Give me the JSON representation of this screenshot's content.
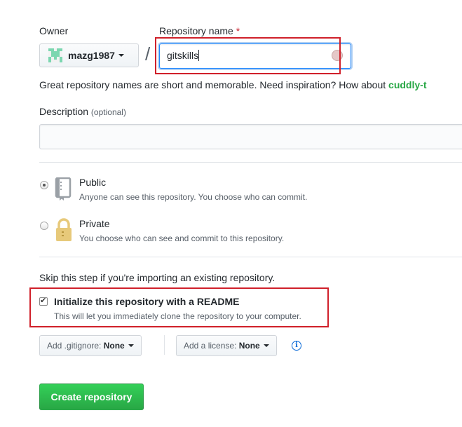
{
  "owner": {
    "label": "Owner",
    "username": "mazg1987"
  },
  "repository": {
    "label": "Repository name",
    "required_mark": "*",
    "value": "gitskills",
    "hint_text": "Great repository names are short and memorable. Need inspiration? How about ",
    "suggestion": "cuddly-t"
  },
  "description": {
    "label": "Description",
    "optional": "(optional)",
    "value": ""
  },
  "visibility": {
    "public": {
      "title": "Public",
      "note": "Anyone can see this repository. You choose who can commit.",
      "selected": true
    },
    "private": {
      "title": "Private",
      "note": "You choose who can see and commit to this repository.",
      "selected": false
    }
  },
  "init": {
    "skip_text": "Skip this step if you're importing an existing repository.",
    "title": "Initialize this repository with a README",
    "note": "This will let you immediately clone the repository to your computer.",
    "checked": true
  },
  "gitignore": {
    "prefix": "Add .gitignore:",
    "value": "None"
  },
  "license": {
    "prefix": "Add a license:",
    "value": "None"
  },
  "create_button": "Create repository",
  "colors": {
    "primary_green": "#28a745",
    "highlight_red": "#d0202a",
    "focus_blue": "#2188ff",
    "link_blue": "#0366d6"
  },
  "icons": [
    "identicon-avatar",
    "caret-down-icon",
    "repo-book-icon",
    "lock-icon",
    "info-icon"
  ]
}
